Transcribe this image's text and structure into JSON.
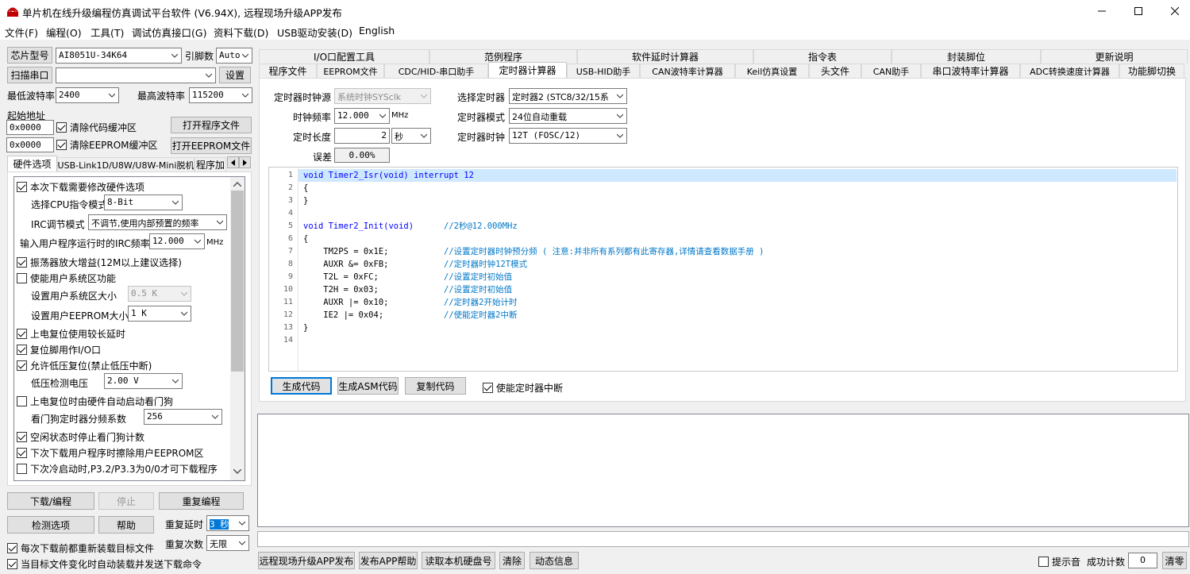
{
  "window": {
    "title": "单片机在线升级编程仿真调试平台软件 (V6.94X), 远程现场升级APP发布",
    "controls": [
      "minimize-icon",
      "maximize-icon",
      "close-icon"
    ]
  },
  "menu": [
    "文件(F)",
    "编程(O)",
    "工具(T)",
    "调试仿真接口(G)",
    "资料下载(D)",
    "USB驱动安装(D)",
    "English"
  ],
  "left": {
    "chip_label": "芯片型号",
    "chip_value": "AI8051U-34K64",
    "pins_label": "引脚数",
    "pins_value": "Auto",
    "scan_button": "扫描串口",
    "port_value": "",
    "settings_button": "设置",
    "min_baud_label": "最低波特率",
    "min_baud_value": "2400",
    "max_baud_label": "最高波特率",
    "max_baud_value": "115200",
    "start_addr_label": "起始地址",
    "addr1_value": "0x0000",
    "clear_code_label": "清除代码缓冲区",
    "open_program_button": "打开程序文件",
    "addr2_value": "0x0000",
    "clear_eeprom_label": "清除EEPROM缓冲区",
    "open_eeprom_button": "打开EEPROM文件",
    "tabs": [
      "硬件选项",
      "USB-Link1D/U8W/U8W-Mini脱机",
      "程序加"
    ],
    "hw": {
      "modify_label": "本次下载需要修改硬件选项",
      "cpu_mode_label": "选择CPU指令模式",
      "cpu_mode_value": "8-Bit",
      "irc_label": "IRC调节模式",
      "irc_value": "不调节,使用内部预置的频率",
      "irc_freq_label": "输入用户程序运行时的IRC频率",
      "irc_freq_value": "12.000",
      "irc_freq_unit": "MHz",
      "osc_gain_label": "振荡器放大增益(12M以上建议选择)",
      "user_sys_label": "使能用户系统区功能",
      "user_sys_size_label": "设置用户系统区大小",
      "user_sys_size_value": "0.5 K",
      "user_eeprom_label": "设置用户EEPROM大小",
      "user_eeprom_value": "1   K",
      "long_delay_label": "上电复位使用较长延时",
      "reset_io_label": "复位脚用作I/O口",
      "lvd_reset_label": "允许低压复位(禁止低压中断)",
      "lvd_voltage_label": "低压检测电压",
      "lvd_voltage_value": "2.00 V",
      "wdt_auto_label": "上电复位时由硬件自动启动看门狗",
      "wdt_div_label": "看门狗定时器分频系数",
      "wdt_div_value": "256",
      "idle_wdt_label": "空闲状态时停止看门狗计数",
      "erase_eeprom_label": "下次下载用户程序时擦除用户EEPROM区",
      "cold_boot_label": "下次冷启动时,P3.2/P3.3为0/0才可下载程序"
    },
    "download_button": "下载/编程",
    "stop_button": "停止",
    "reprogram_button": "重复编程",
    "detect_button": "检测选项",
    "help_button": "帮助",
    "repeat_delay_label": "重复延时",
    "repeat_delay_value": "3 秒",
    "repeat_count_label": "重复次数",
    "repeat_count_value": "无限",
    "reload_label": "每次下载前都重新装载目标文件",
    "auto_send_label": "当目标文件变化时自动装载并发送下载命令"
  },
  "tabs_row1": [
    "I/O口配置工具",
    "范例程序",
    "软件延时计算器",
    "指令表",
    "封装脚位",
    "更新说明"
  ],
  "tabs_row2": [
    "程序文件",
    "EEPROM文件",
    "CDC/HID-串口助手",
    "定时器计算器",
    "USB-HID助手",
    "CAN波特率计算器",
    "Keil仿真设置",
    "头文件",
    "CAN助手",
    "串口波特率计算器",
    "ADC转换速度计算器",
    "功能脚切换"
  ],
  "timer": {
    "clock_src_label": "定时器时钟源",
    "clock_src_value": "系统时钟SYSclk",
    "select_timer_label": "选择定时器",
    "select_timer_value": "定时器2 (STC8/32/15系",
    "freq_label": "时钟频率",
    "freq_value": "12.000",
    "freq_unit": "MHz",
    "mode_label": "定时器模式",
    "mode_value": "24位自动重载",
    "length_label": "定时长度",
    "length_value": "2",
    "length_unit": "秒",
    "timer_clock_label": "定时器时钟",
    "timer_clock_value": "12T (FOSC/12)",
    "error_label": "误差",
    "error_value": "0.00%",
    "gen_code_button": "生成代码",
    "gen_asm_button": "生成ASM代码",
    "copy_button": "复制代码",
    "enable_int_label": "使能定时器中断"
  },
  "code_lines": [
    {
      "n": "1",
      "code": "void Timer2_Isr(void) interrupt 12",
      "comment": ""
    },
    {
      "n": "2",
      "code": "{",
      "comment": ""
    },
    {
      "n": "3",
      "code": "}",
      "comment": ""
    },
    {
      "n": "4",
      "code": "",
      "comment": ""
    },
    {
      "n": "5",
      "code": "void Timer2_Init(void)      ",
      "comment": "//2秒@12.000MHz"
    },
    {
      "n": "6",
      "code": "{",
      "comment": ""
    },
    {
      "n": "7",
      "code": "    TM2PS = 0x1E;           ",
      "comment": "//设置定时器时钟预分频 ( 注意:并非所有系列都有此寄存器,详情请查看数据手册 )"
    },
    {
      "n": "8",
      "code": "    AUXR &= 0xFB;           ",
      "comment": "//定时器时钟12T模式"
    },
    {
      "n": "9",
      "code": "    T2L = 0xFC;             ",
      "comment": "//设置定时初始值"
    },
    {
      "n": "10",
      "code": "    T2H = 0x03;             ",
      "comment": "//设置定时初始值"
    },
    {
      "n": "11",
      "code": "    AUXR |= 0x10;           ",
      "comment": "//定时器2开始计时"
    },
    {
      "n": "12",
      "code": "    IE2 |= 0x04;            ",
      "comment": "//使能定时器2中断"
    },
    {
      "n": "13",
      "code": "}",
      "comment": ""
    },
    {
      "n": "14",
      "code": "",
      "comment": ""
    }
  ],
  "bottom": {
    "publish_button": "远程现场升级APP发布",
    "publish_help_button": "发布APP帮助",
    "read_disk_button": "读取本机硬盘号",
    "clear_button": "清除",
    "dynamic_button": "动态信息",
    "sound_label": "提示音",
    "success_label": "成功计数",
    "success_value": "0",
    "reset_count_button": "清零"
  },
  "colors": {
    "keyword": "#0000ff",
    "comment": "#0078c8",
    "selection": "#cde8ff",
    "accent": "#0078d7"
  }
}
